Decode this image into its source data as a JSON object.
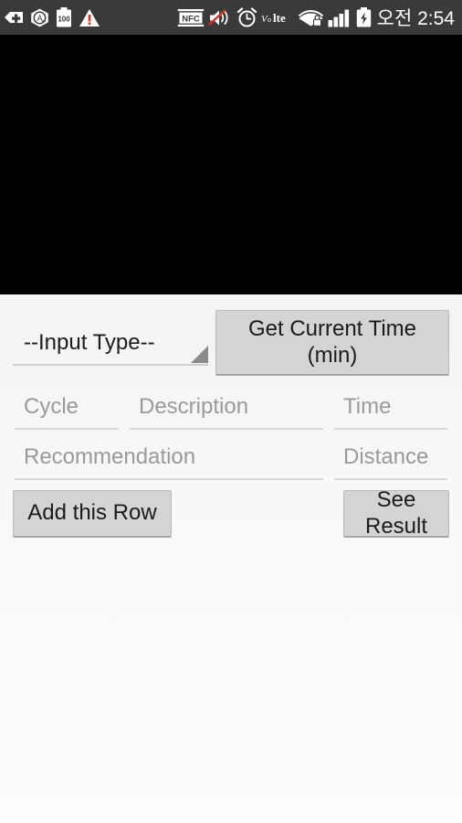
{
  "status_bar": {
    "background_color": "#3a3a3a",
    "time": "오전 2:54",
    "left_icons": [
      {
        "name": "medical-plus-tag-icon",
        "label": "Emergency mode"
      },
      {
        "name": "assistant-a-icon",
        "label": "Assistant"
      },
      {
        "name": "battery-100-icon",
        "label": "100"
      },
      {
        "name": "warning-triangle-icon",
        "label": "Warning"
      }
    ],
    "right_icons": [
      {
        "name": "nfc-icon",
        "label": "NFC"
      },
      {
        "name": "sound-mute-icon",
        "label": "Muted"
      },
      {
        "name": "alarm-clock-icon",
        "label": "Alarm"
      },
      {
        "name": "volte-icon",
        "label": "VoLTE"
      },
      {
        "name": "wifi-secured-icon",
        "label": "Wi-Fi secured"
      },
      {
        "name": "signal-bars-icon",
        "label": "Signal"
      },
      {
        "name": "battery-charging-icon",
        "label": "Charging"
      }
    ]
  },
  "viewport": {
    "name": "black-preview-area",
    "background_color": "#000000"
  },
  "form": {
    "spinner": {
      "selected": "--Input Type--"
    },
    "get_time_button": {
      "line1": "Get Current Time",
      "line2": "(min)"
    },
    "fields": [
      {
        "key": "cycle",
        "placeholder": "Cycle",
        "value": ""
      },
      {
        "key": "description",
        "placeholder": "Description",
        "value": ""
      },
      {
        "key": "time",
        "placeholder": "Time",
        "value": ""
      },
      {
        "key": "recommendation",
        "placeholder": "Recommendation",
        "value": ""
      },
      {
        "key": "distance",
        "placeholder": "Distance",
        "value": ""
      }
    ],
    "add_row_button": "Add this Row",
    "see_result_button": "See Result"
  },
  "colors": {
    "button_face": "#d4d4d4",
    "button_border": "#b9b9b9",
    "field_underline": "#d8d8d8",
    "placeholder_text": "#9a9a9a",
    "body_text": "#1b1b1b"
  }
}
